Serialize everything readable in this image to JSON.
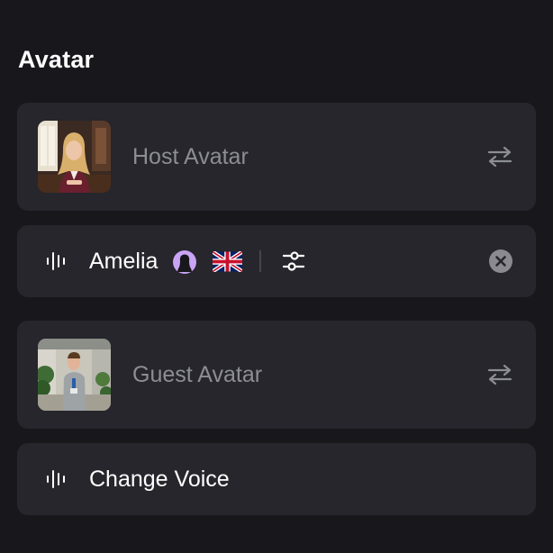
{
  "section": {
    "title": "Avatar"
  },
  "host": {
    "label": "Host Avatar",
    "thumbnail_icon": "host-avatar-photo",
    "swap_icon": "swap-arrows-icon"
  },
  "host_voice": {
    "name": "Amelia",
    "gender_icon": "female-person-icon",
    "language_icon": "uk-flag-icon",
    "settings_icon": "sliders-icon",
    "clear_icon": "close-circle-icon"
  },
  "guest": {
    "label": "Guest Avatar",
    "thumbnail_icon": "guest-avatar-photo",
    "swap_icon": "swap-arrows-icon"
  },
  "guest_voice": {
    "label": "Change Voice",
    "voice_icon": "audio-wave-icon"
  },
  "colors": {
    "background": "#17171c",
    "card": "#26262c",
    "text_primary": "#ffffff",
    "text_muted": "#8d8d94",
    "gender_badge": "#c9a4f5"
  }
}
